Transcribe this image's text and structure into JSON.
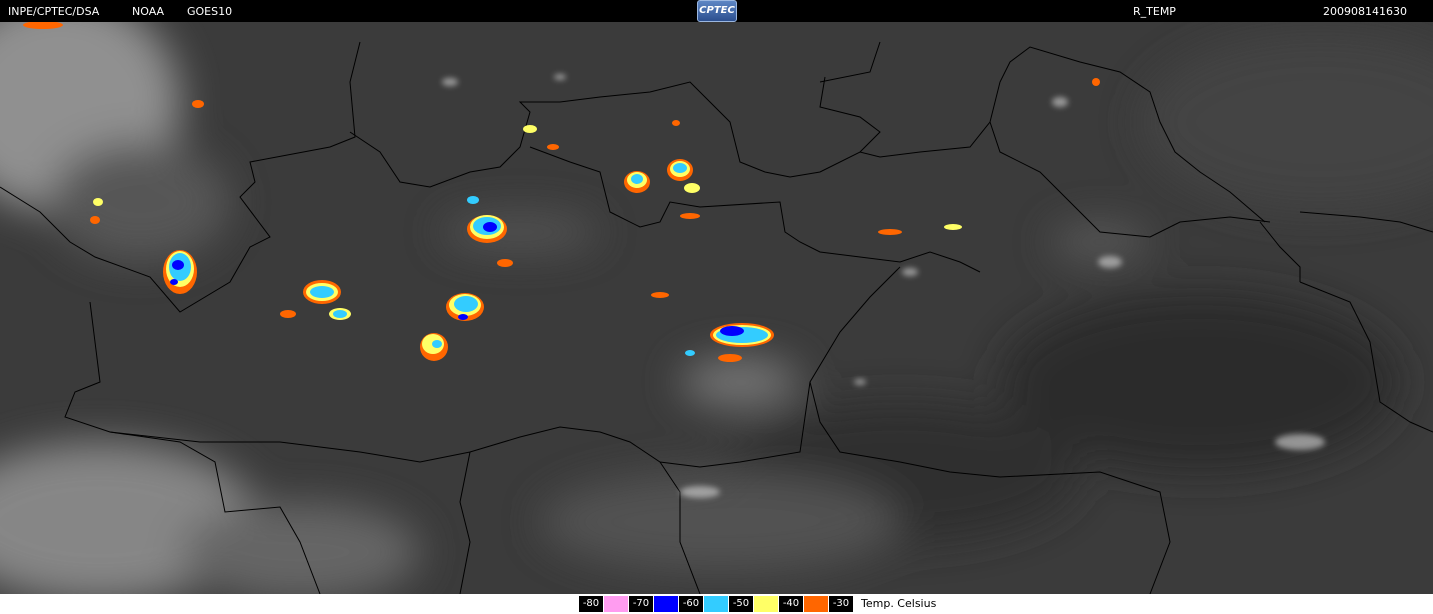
{
  "header": {
    "source": "INPE/CPTEC/DSA",
    "agency": "NOAA",
    "satellite": "GOES10",
    "logo_text": "CPTEC",
    "product": "R_TEMP",
    "datetime": "200908141630"
  },
  "legend": {
    "title": "Temp. Celsius",
    "entries": [
      {
        "label": "-80",
        "color": "#ff9cf0"
      },
      {
        "label": "-70",
        "color": "#0000ff"
      },
      {
        "label": "-60",
        "color": "#33ccff"
      },
      {
        "label": "-50",
        "color": "#ffff66"
      },
      {
        "label": "-40",
        "color": "#ff6600"
      },
      {
        "label": "-30",
        "color": null
      }
    ]
  },
  "colors": {
    "background_cloud": "#3a3a3a",
    "border_lines": "#000000"
  }
}
